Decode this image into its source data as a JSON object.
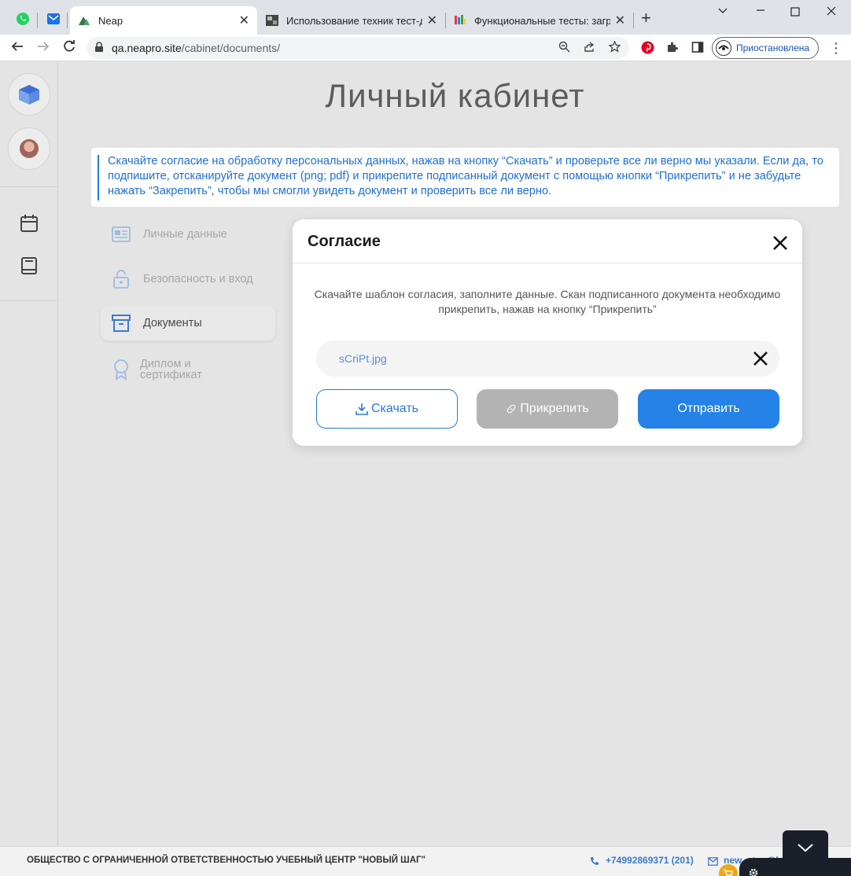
{
  "browser": {
    "tabs": [
      {
        "title": "Neap",
        "active": true
      },
      {
        "title": "Использование техник тест-дизайна",
        "active": false
      },
      {
        "title": "Функциональные тесты: загрузка",
        "active": false
      }
    ],
    "address": {
      "host": "qa.neapro.site",
      "path": "/cabinet/documents/"
    },
    "profile_status": "Приостановлена"
  },
  "page": {
    "title": "Личный кабинет",
    "notice": "Скачайте согласие на обработку персональных данных, нажав на кнопку “Скачать” и проверьте все ли верно мы указали. Если да, то подпишите, отсканируйте документ (png; pdf) и прикрепите подписанный документ с помощью кнопки “Прикрепить” и не забудьте нажать “Закрепить”, чтобы мы смогли увидеть документ и проверить все ли верно."
  },
  "menu": {
    "items": [
      {
        "label": "Личные данные",
        "icon": "id-card-icon",
        "active": false
      },
      {
        "label": "Безопасность и вход",
        "icon": "unlock-icon",
        "active": false
      },
      {
        "label": "Документы",
        "icon": "archive-icon",
        "active": true
      },
      {
        "label": "Диплом и\nсертификат",
        "icon": "badge-icon",
        "active": false
      }
    ]
  },
  "modal": {
    "title": "Согласие",
    "description": "Скачайте шаблон согласия, заполните данные. Скан подписанного документа необходимо прикрепить, нажав на кнопку “Прикрепить”",
    "file_name": "sCriPt.jpg",
    "buttons": {
      "download": "Скачать",
      "attach": "Прикрепить",
      "send": "Отправить"
    }
  },
  "footer": {
    "company": "ОБЩЕСТВО С ОГРАНИЧЕННОЙ ОТВЕТСТВЕННОСТЬЮ УЧЕБНЫЙ ЦЕНТР \"НОВЫЙ ШАГ\"",
    "phone": "+74992869371 (201)",
    "email": "new_step@l"
  },
  "colors": {
    "accent": "#2582e6",
    "link": "#1f6fd0",
    "disabled": "#b3b3b3",
    "background": "#e4e4e4"
  }
}
